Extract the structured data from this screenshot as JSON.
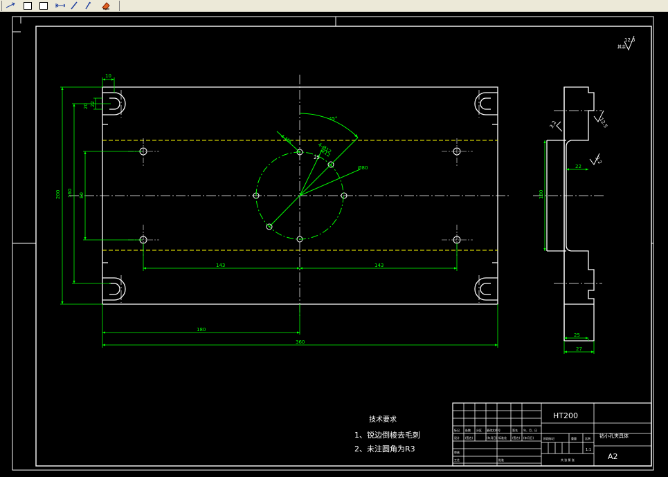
{
  "toolbar": {
    "icons": [
      "line-arrow-icon",
      "rectangle-icon",
      "rectangle-alt-icon",
      "dimension-icon",
      "pencil-icon",
      "pen-icon",
      "eraser-icon"
    ]
  },
  "colors": {
    "background": "#000000",
    "outline": "#ffffff",
    "dimension": "#00ff00",
    "hidden_line": "#ffff00",
    "roughness": "#ffffff"
  },
  "roughness": {
    "value": "12.5",
    "label": "其余"
  },
  "front_view": {
    "dims": {
      "top_width": "10",
      "slot_a": "20",
      "slot_b": "22",
      "height_overall": "200",
      "height_160": "160",
      "height_80": "80",
      "left_143": "143",
      "right_143": "143",
      "half_180": "180",
      "total_360": "360",
      "angle": "45°",
      "hole_label": "4-M6",
      "hole_label2": "4-Ø12",
      "hole_depth": "深12",
      "pcd": "Ø80",
      "rough25": "25"
    }
  },
  "side_view": {
    "dims": {
      "height_180": "180",
      "depth_22": "22",
      "bottom_25": "25",
      "bottom_27": "27",
      "rough_a": "12.5",
      "rough_b": "3.2",
      "rough_c": "3.2"
    }
  },
  "notes": {
    "title": "技术要求",
    "items": [
      "1、锐边倒棱去毛刺",
      "2、未注圆角为R3"
    ]
  },
  "title_block": {
    "material": "HT200",
    "part_name": "钻小孔夹具体",
    "sheet_size": "A2",
    "scale": "1:1",
    "row1": [
      "标记",
      "处数",
      "分区",
      "更改文件号",
      "签名",
      "年、月、日"
    ],
    "row2": [
      "设计",
      "(签名)",
      "(年月日)",
      "标准化",
      "(签名)",
      "(年月日)"
    ],
    "stage": "阶段标记",
    "weight": "重量",
    "ratio": "比例",
    "review": "审核",
    "process": "工艺",
    "approve": "批准",
    "sheet": "共 张 第 张"
  }
}
